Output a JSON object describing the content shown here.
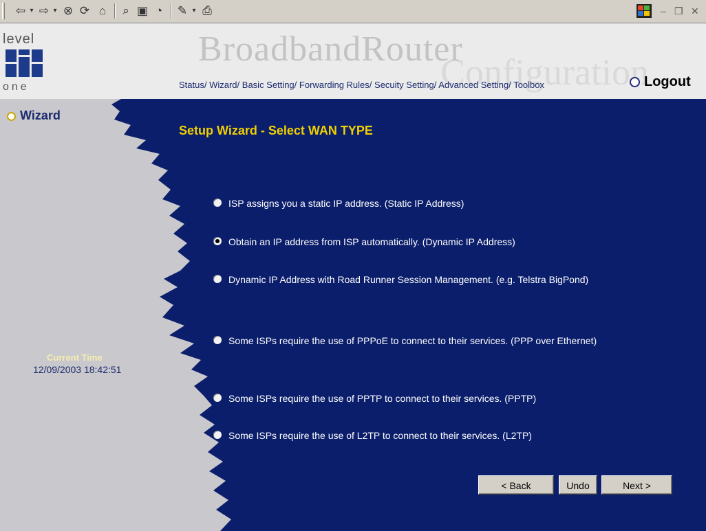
{
  "header": {
    "logo_top": "level",
    "logo_bottom": "one",
    "brand": "BroadbandRouter",
    "watermark": "Configuration",
    "nav": [
      "Status/",
      "Wizard/",
      "Basic Setting/",
      "Forwarding Rules/",
      "Secuity Setting/",
      "Advanced Setting/",
      "Toolbox"
    ],
    "logout": "Logout"
  },
  "sidebar": {
    "wizard": "Wizard",
    "current_time_label": "Current Time",
    "current_time_value": "12/09/2003 18:42:51"
  },
  "main": {
    "title": "Setup Wizard - Select WAN TYPE",
    "options": [
      {
        "label": "ISP assigns you a static IP address. (Static IP Address)",
        "selected": false
      },
      {
        "label": "Obtain an IP address from ISP automatically. (Dynamic IP Address)",
        "selected": true
      },
      {
        "label": "Dynamic IP Address with Road Runner Session Management. (e.g. Telstra BigPond)",
        "selected": false
      },
      {
        "label": "Some ISPs require the use of PPPoE to connect to their services. (PPP over Ethernet)",
        "selected": false
      },
      {
        "label": "Some ISPs require the use of PPTP to connect to their services. (PPTP)",
        "selected": false
      },
      {
        "label": "Some ISPs require the use of L2TP to connect to their services. (L2TP)",
        "selected": false
      }
    ],
    "buttons": {
      "back": "< Back",
      "undo": "Undo",
      "next": "Next >"
    }
  },
  "toolbar": {
    "icons": [
      "back-icon",
      "forward-icon",
      "stop-icon",
      "refresh-icon",
      "home-icon",
      "search-icon",
      "favorites-icon",
      "history-icon",
      "edit-icon",
      "print-icon"
    ],
    "window_controls": [
      "–",
      "ȶ",
      "×"
    ]
  },
  "colors": {
    "main_bg": "#0b1e6b",
    "left_bg": "#c9c8cc",
    "title": "#f0d000",
    "header_bg": "#ebebeb"
  }
}
